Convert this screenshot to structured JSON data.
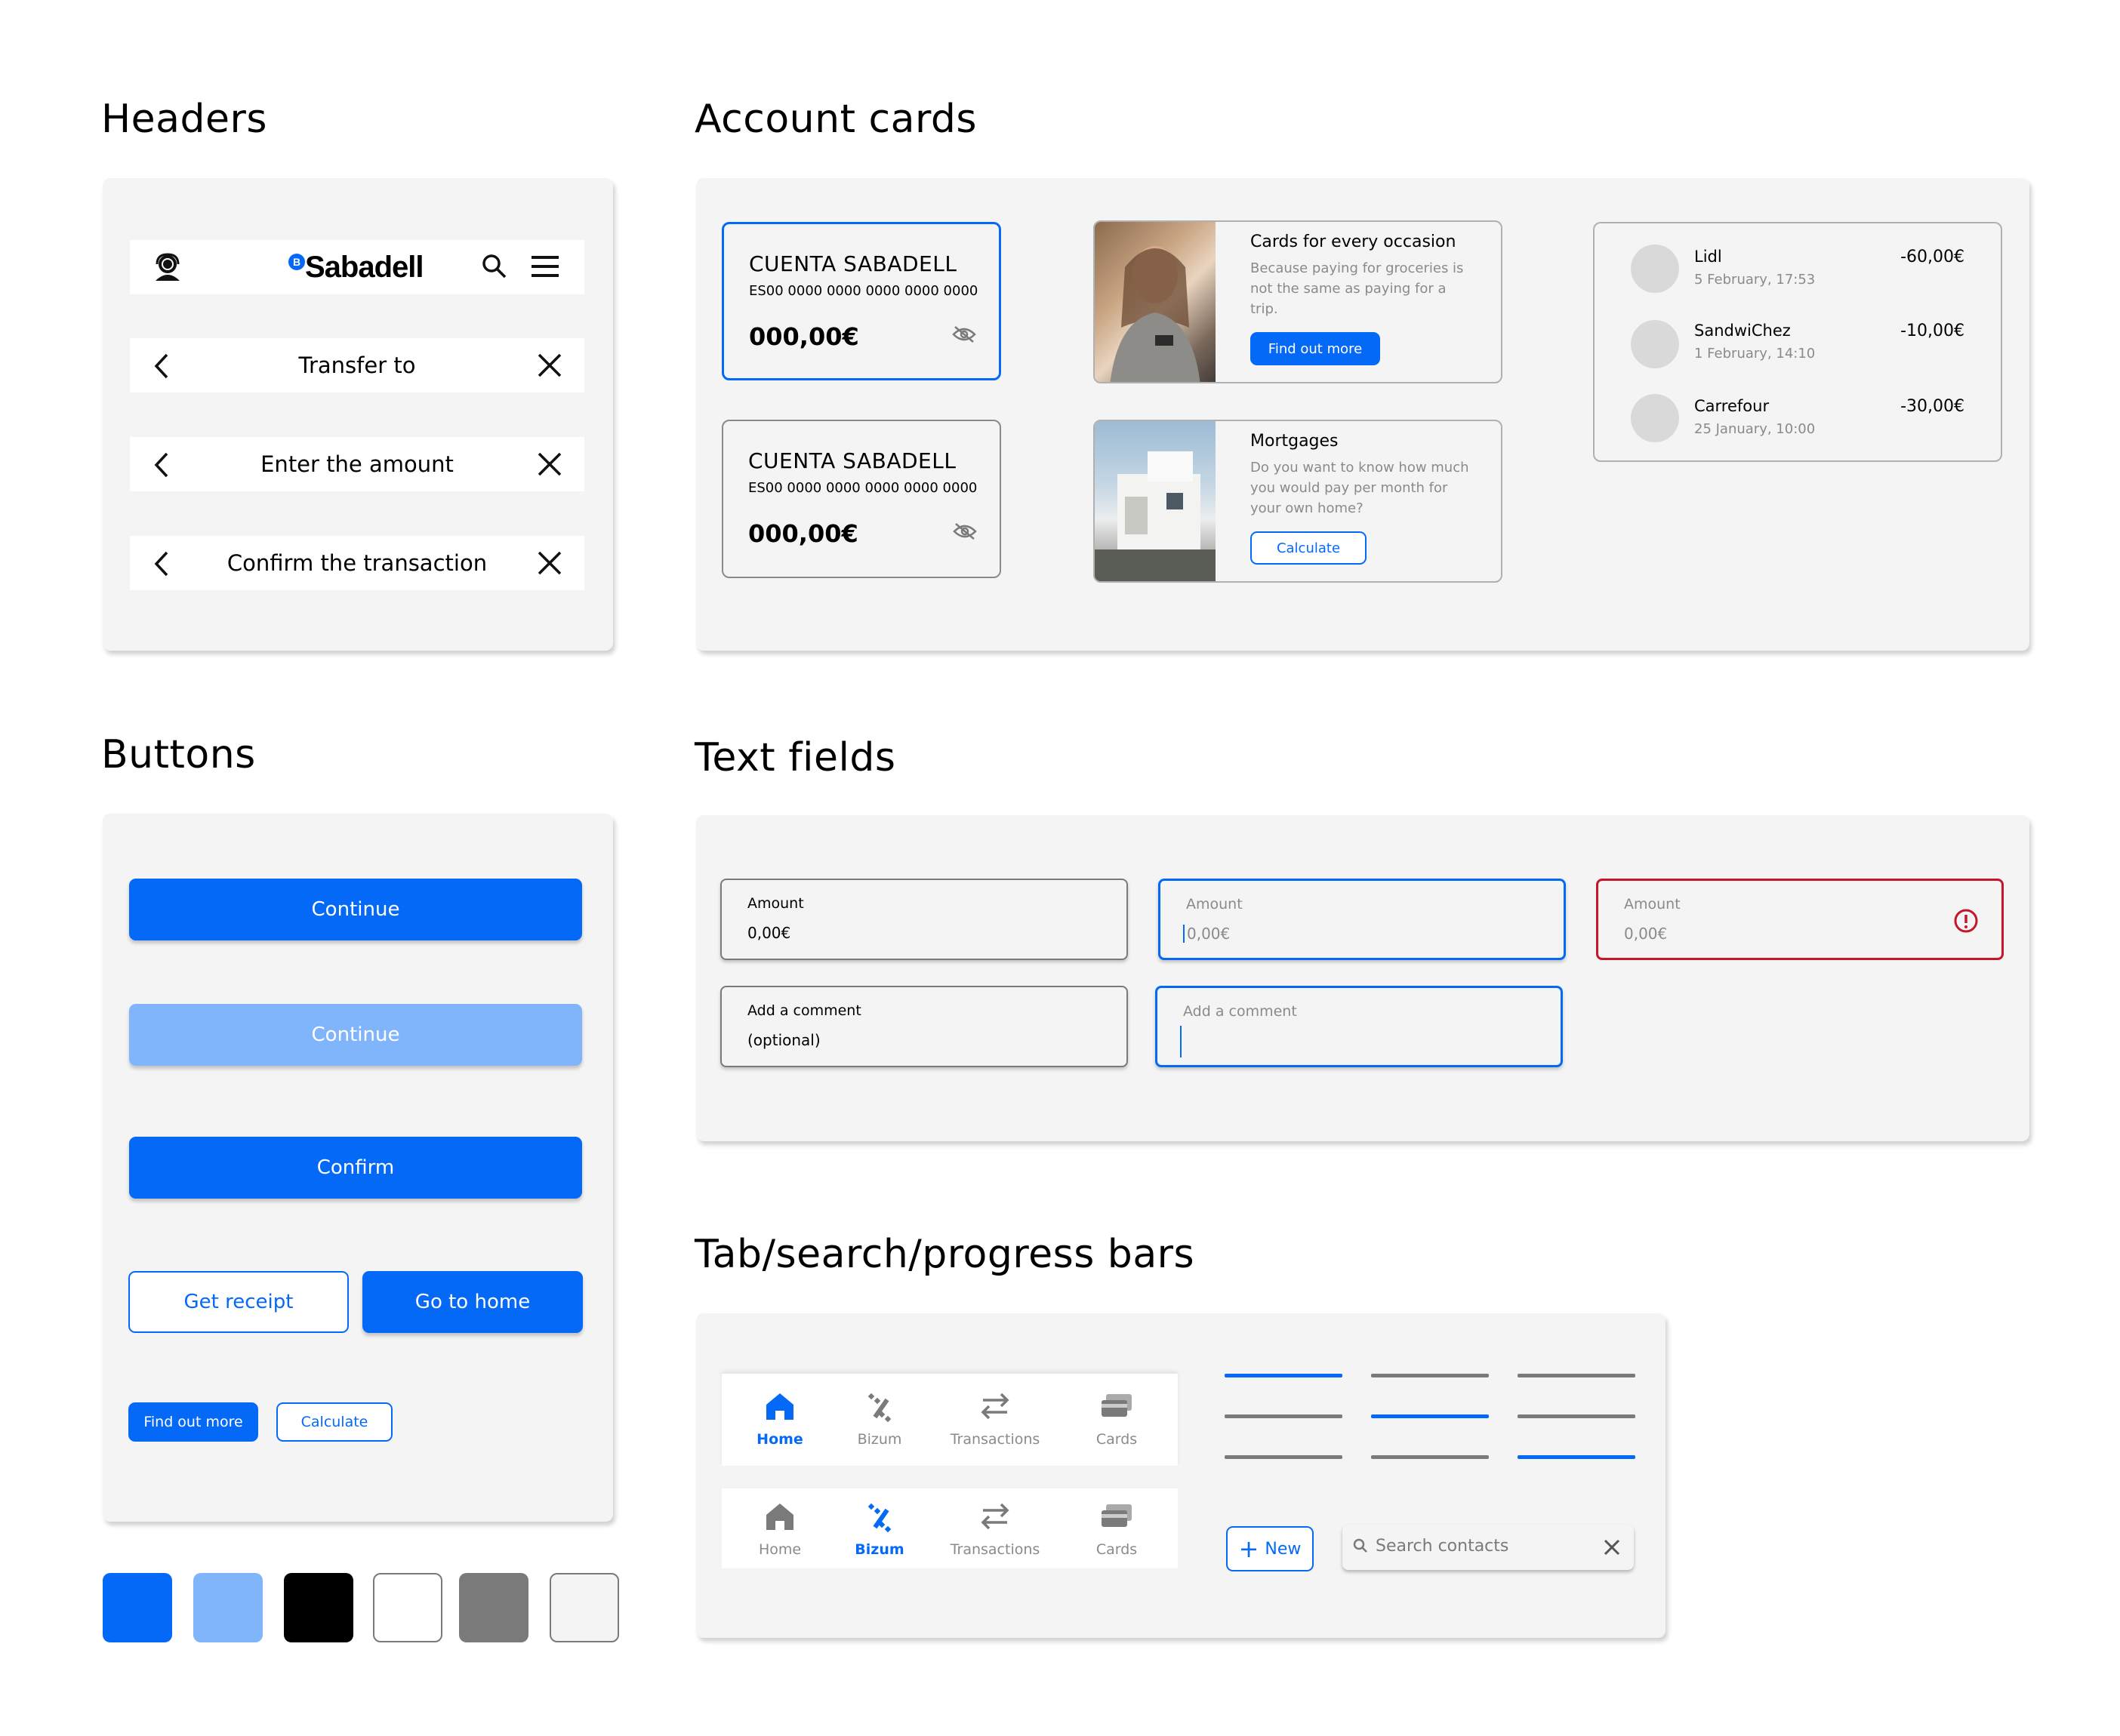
{
  "sections": {
    "headers": "Headers",
    "account_cards": "Account cards",
    "buttons": "Buttons",
    "text_fields": "Text fields",
    "tabs": "Tab/search/progress bars"
  },
  "headers": {
    "logo": "Sabadell",
    "logo_badge": "B",
    "titles": [
      "Transfer to",
      "Enter the amount",
      "Confirm the transaction"
    ]
  },
  "buttons": {
    "continue": "Continue",
    "continue_disabled": "Continue",
    "confirm": "Confirm",
    "get_receipt": "Get receipt",
    "go_home": "Go to home",
    "find_out_more": "Find out more",
    "calculate": "Calculate"
  },
  "colors": {
    "primary": "#0569f8",
    "primary_light": "#80b5fc",
    "black": "#000000",
    "white": "#ffffff",
    "grey": "#7a7a7a",
    "light_grey": "#f4f4f4",
    "error": "#c4172c"
  },
  "accounts": [
    {
      "name": "CUENTA SABADELL",
      "iban": "ES00 0000 0000 0000 0000 0000",
      "amount": "000,00€"
    },
    {
      "name": "CUENTA SABADELL",
      "iban": "ES00 0000 0000 0000 0000 0000",
      "amount": "000,00€"
    }
  ],
  "promos": [
    {
      "title": "Cards for every occasion",
      "desc": "Because paying for groceries is not the same as paying for a trip.",
      "button": "Find out more"
    },
    {
      "title": "Mortgages",
      "desc": "Do you want to know how much you would pay per month for your own home?",
      "button": "Calculate"
    }
  ],
  "transactions": [
    {
      "name": "Lidl",
      "date": "5 February, 17:53",
      "amount": "-60,00€"
    },
    {
      "name": "SandwiChez",
      "date": "1 February, 14:10",
      "amount": "-10,00€"
    },
    {
      "name": "Carrefour",
      "date": "25 January, 10:00",
      "amount": "-30,00€"
    }
  ],
  "fields": {
    "amount_label": "Amount",
    "amount_value": "0,00€",
    "amount_placeholder": "0,00€",
    "comment_label": "Add a comment",
    "comment_value": "(optional)"
  },
  "tabs": [
    "Home",
    "Bizum",
    "Transactions",
    "Cards"
  ],
  "new_button": "New",
  "search_placeholder": "Search contacts",
  "progress": [
    [
      true,
      false,
      false
    ],
    [
      false,
      true,
      false
    ],
    [
      false,
      false,
      true
    ]
  ]
}
